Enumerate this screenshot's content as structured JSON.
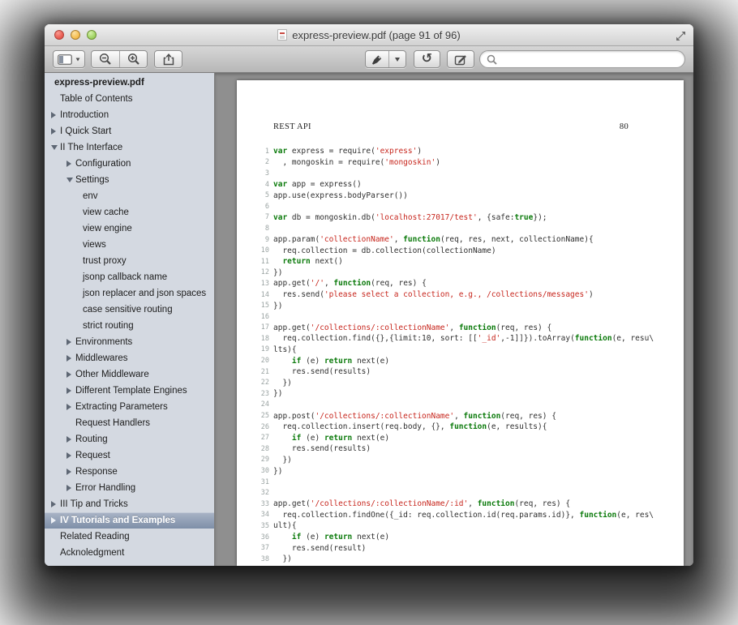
{
  "window": {
    "title": "express-preview.pdf (page 91 of 96)"
  },
  "colors": {
    "sel_top": "#a9b4c6",
    "sel_bottom": "#7e8fa8",
    "code_keyword": "#0b7a0b",
    "code_string": "#c7261d",
    "code_plain": "#2f2f2f",
    "ln_color": "#9ba4a3",
    "sidebar_bg": "#d4d9e1"
  },
  "toolbar": {
    "icons": [
      "sidebar-toggle",
      "zoom-out",
      "zoom-in",
      "share",
      "highlighter",
      "highlighter-dropdown",
      "rotate-left",
      "markup",
      "search"
    ],
    "search": {
      "placeholder": ""
    }
  },
  "sidebar": {
    "items": [
      {
        "label": "express-preview.pdf",
        "level": 0,
        "disclosure": "none",
        "bold": true
      },
      {
        "label": "Table of Contents",
        "level": 1,
        "disclosure": "none"
      },
      {
        "label": "Introduction",
        "level": 1,
        "disclosure": "collapsed"
      },
      {
        "label": "I Quick Start",
        "level": 1,
        "disclosure": "collapsed"
      },
      {
        "label": "II The Interface",
        "level": 1,
        "disclosure": "expanded"
      },
      {
        "label": "Configuration",
        "level": 2,
        "disclosure": "collapsed"
      },
      {
        "label": "Settings",
        "level": 2,
        "disclosure": "expanded"
      },
      {
        "label": "env",
        "level": 3,
        "disclosure": "none"
      },
      {
        "label": "view cache",
        "level": 3,
        "disclosure": "none"
      },
      {
        "label": "view engine",
        "level": 3,
        "disclosure": "none"
      },
      {
        "label": "views",
        "level": 3,
        "disclosure": "none"
      },
      {
        "label": "trust proxy",
        "level": 3,
        "disclosure": "none"
      },
      {
        "label": "jsonp callback name",
        "level": 3,
        "disclosure": "none"
      },
      {
        "label": "json replacer and json spaces",
        "level": 3,
        "disclosure": "none"
      },
      {
        "label": "case sensitive routing",
        "level": 3,
        "disclosure": "none"
      },
      {
        "label": "strict routing",
        "level": 3,
        "disclosure": "none"
      },
      {
        "label": "Environments",
        "level": 2,
        "disclosure": "collapsed"
      },
      {
        "label": "Middlewares",
        "level": 2,
        "disclosure": "collapsed"
      },
      {
        "label": "Other Middleware",
        "level": 2,
        "disclosure": "collapsed"
      },
      {
        "label": "Different Template Engines",
        "level": 2,
        "disclosure": "collapsed"
      },
      {
        "label": "Extracting Parameters",
        "level": 2,
        "disclosure": "collapsed"
      },
      {
        "label": "Request Handlers",
        "level": 2,
        "disclosure": "none"
      },
      {
        "label": "Routing",
        "level": 2,
        "disclosure": "collapsed"
      },
      {
        "label": "Request",
        "level": 2,
        "disclosure": "collapsed"
      },
      {
        "label": "Response",
        "level": 2,
        "disclosure": "collapsed"
      },
      {
        "label": "Error Handling",
        "level": 2,
        "disclosure": "collapsed"
      },
      {
        "label": "III Tip and Tricks",
        "level": 1,
        "disclosure": "collapsed"
      },
      {
        "label": "IV Tutorials and Examples",
        "level": 1,
        "disclosure": "collapsed",
        "selected": true
      },
      {
        "label": "Related Reading",
        "level": 1,
        "disclosure": "none"
      },
      {
        "label": "Acknoledgment",
        "level": 1,
        "disclosure": "none"
      }
    ]
  },
  "doc": {
    "header_left": "REST API",
    "page_number": "80",
    "code_lines": [
      [
        [
          "k",
          "var"
        ],
        [
          "p",
          " express = require("
        ],
        [
          "s",
          "'express'"
        ],
        [
          "p",
          ")"
        ]
      ],
      [
        [
          "p",
          "  , mongoskin = require("
        ],
        [
          "s",
          "'mongoskin'"
        ],
        [
          "p",
          ")"
        ]
      ],
      [],
      [
        [
          "k",
          "var"
        ],
        [
          "p",
          " app = express()"
        ]
      ],
      [
        [
          "p",
          "app.use(express.bodyParser())"
        ]
      ],
      [],
      [
        [
          "k",
          "var"
        ],
        [
          "p",
          " db = mongoskin.db("
        ],
        [
          "s",
          "'localhost:27017/test'"
        ],
        [
          "p",
          ", {safe:"
        ],
        [
          "k",
          "true"
        ],
        [
          "p",
          "});"
        ]
      ],
      [],
      [
        [
          "p",
          "app.param("
        ],
        [
          "s",
          "'collectionName'"
        ],
        [
          "p",
          ", "
        ],
        [
          "k",
          "function"
        ],
        [
          "p",
          "(req, res, next, collectionName){"
        ]
      ],
      [
        [
          "p",
          "  req.collection = db.collection(collectionName)"
        ]
      ],
      [
        [
          "p",
          "  "
        ],
        [
          "k",
          "return"
        ],
        [
          "p",
          " next()"
        ]
      ],
      [
        [
          "p",
          "})"
        ]
      ],
      [
        [
          "p",
          "app.get("
        ],
        [
          "s",
          "'/'"
        ],
        [
          "p",
          ", "
        ],
        [
          "k",
          "function"
        ],
        [
          "p",
          "(req, res) {"
        ]
      ],
      [
        [
          "p",
          "  res.send("
        ],
        [
          "s",
          "'please select a collection, e.g., /collections/messages'"
        ],
        [
          "p",
          ")"
        ]
      ],
      [
        [
          "p",
          "})"
        ]
      ],
      [],
      [
        [
          "p",
          "app.get("
        ],
        [
          "s",
          "'/collections/:collectionName'"
        ],
        [
          "p",
          ", "
        ],
        [
          "k",
          "function"
        ],
        [
          "p",
          "(req, res) {"
        ]
      ],
      [
        [
          "p",
          "  req.collection.find({},{limit:10, sort: [["
        ],
        [
          "s",
          "'_id'"
        ],
        [
          "p",
          ",-1]]}).toArray("
        ],
        [
          "k",
          "function"
        ],
        [
          "p",
          "(e, resu\\"
        ]
      ],
      [
        [
          "p",
          "lts){"
        ]
      ],
      [
        [
          "p",
          "    "
        ],
        [
          "k",
          "if"
        ],
        [
          "p",
          " (e) "
        ],
        [
          "k",
          "return"
        ],
        [
          "p",
          " next(e)"
        ]
      ],
      [
        [
          "p",
          "    res.send(results)"
        ]
      ],
      [
        [
          "p",
          "  })"
        ]
      ],
      [
        [
          "p",
          "})"
        ]
      ],
      [],
      [
        [
          "p",
          "app.post("
        ],
        [
          "s",
          "'/collections/:collectionName'"
        ],
        [
          "p",
          ", "
        ],
        [
          "k",
          "function"
        ],
        [
          "p",
          "(req, res) {"
        ]
      ],
      [
        [
          "p",
          "  req.collection.insert(req.body, {}, "
        ],
        [
          "k",
          "function"
        ],
        [
          "p",
          "(e, results){"
        ]
      ],
      [
        [
          "p",
          "    "
        ],
        [
          "k",
          "if"
        ],
        [
          "p",
          " (e) "
        ],
        [
          "k",
          "return"
        ],
        [
          "p",
          " next(e)"
        ]
      ],
      [
        [
          "p",
          "    res.send(results)"
        ]
      ],
      [
        [
          "p",
          "  })"
        ]
      ],
      [
        [
          "p",
          "})"
        ]
      ],
      [],
      [],
      [
        [
          "p",
          "app.get("
        ],
        [
          "s",
          "'/collections/:collectionName/:id'"
        ],
        [
          "p",
          ", "
        ],
        [
          "k",
          "function"
        ],
        [
          "p",
          "(req, res) {"
        ]
      ],
      [
        [
          "p",
          "  req.collection.findOne({_id: req.collection.id(req.params.id)}, "
        ],
        [
          "k",
          "function"
        ],
        [
          "p",
          "(e, res\\"
        ]
      ],
      [
        [
          "p",
          "ult){"
        ]
      ],
      [
        [
          "p",
          "    "
        ],
        [
          "k",
          "if"
        ],
        [
          "p",
          " (e) "
        ],
        [
          "k",
          "return"
        ],
        [
          "p",
          " next(e)"
        ]
      ],
      [
        [
          "p",
          "    res.send(result)"
        ]
      ],
      [
        [
          "p",
          "  })"
        ]
      ]
    ]
  }
}
